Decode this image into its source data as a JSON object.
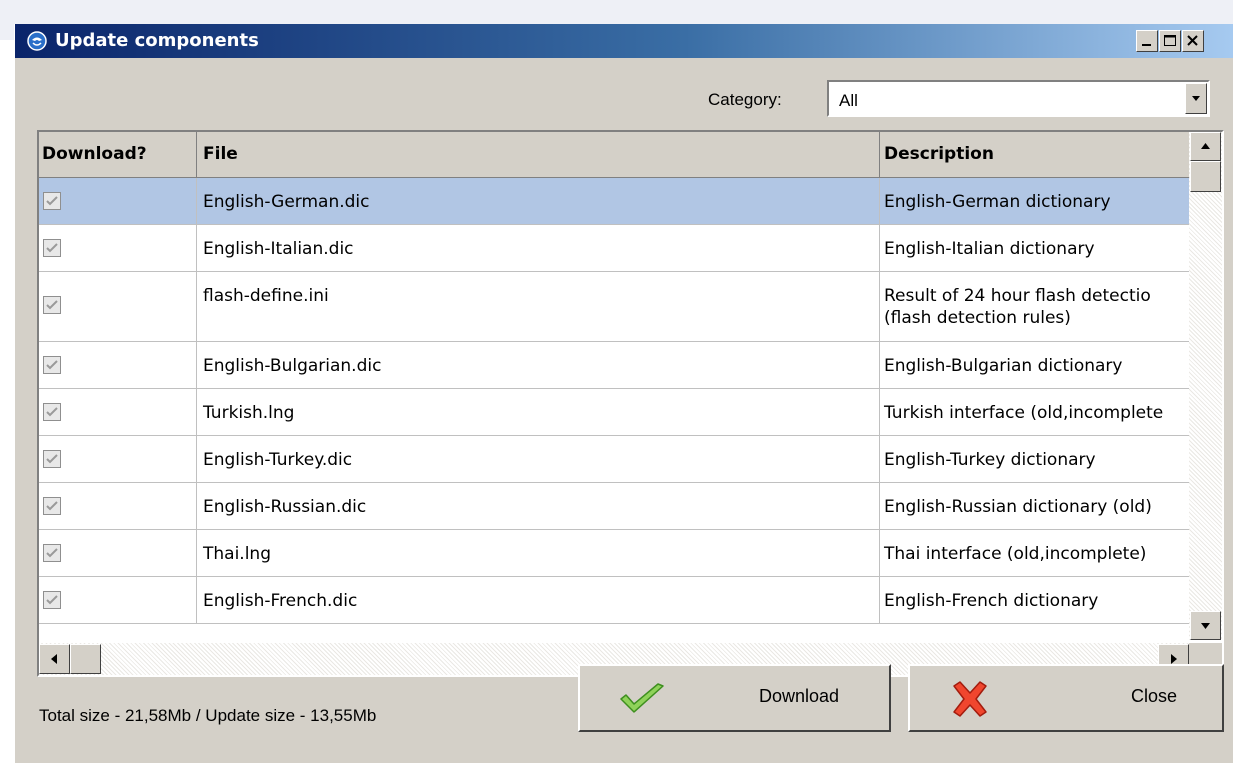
{
  "window": {
    "title": "Update components"
  },
  "filter": {
    "category_label": "Category:",
    "category_value": "All"
  },
  "table": {
    "headers": [
      "Download?",
      "File",
      "Description"
    ],
    "rows": [
      {
        "download": true,
        "file": "English-German.dic",
        "description": "English-German dictionary",
        "selected": true
      },
      {
        "download": true,
        "file": "English-Italian.dic",
        "description": "English-Italian dictionary"
      },
      {
        "download": true,
        "file": "flash-define.ini",
        "description": "Result of 24 hour flash detectio",
        "description2": "(flash detection rules)"
      },
      {
        "download": true,
        "file": "English-Bulgarian.dic",
        "description": "English-Bulgarian dictionary"
      },
      {
        "download": true,
        "file": "Turkish.lng",
        "description": "Turkish interface (old,incomplete"
      },
      {
        "download": true,
        "file": "English-Turkey.dic",
        "description": "English-Turkey dictionary"
      },
      {
        "download": true,
        "file": "English-Russian.dic",
        "description": "English-Russian dictionary (old)"
      },
      {
        "download": true,
        "file": "Thai.lng",
        "description": "Thai interface (old,incomplete)"
      },
      {
        "download": true,
        "file": "English-French.dic",
        "description": "English-French dictionary"
      }
    ]
  },
  "status": {
    "text": "Total size - 21,58Mb / Update size - 13,55Mb"
  },
  "buttons": {
    "download": "Download",
    "close": "Close"
  },
  "colors": {
    "selection": "#b1c6e4",
    "titlebar_start": "#0a246a",
    "titlebar_end": "#a6caf0"
  },
  "icons": {
    "app": "globe-icon",
    "download": "checkmark-icon",
    "close": "red-x-icon"
  }
}
